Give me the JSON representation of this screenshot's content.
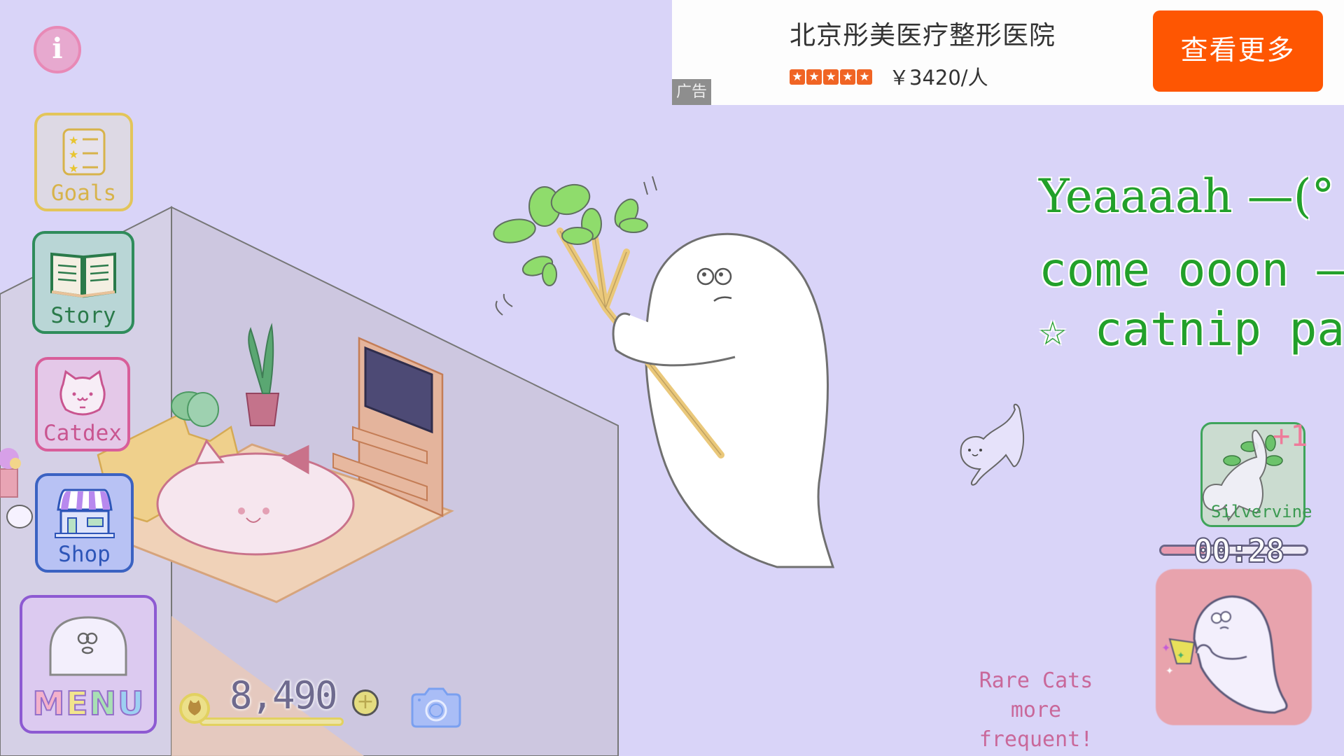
{
  "ad": {
    "title": "北京彤美医疗整形医院",
    "rating_stars": 5,
    "star_glyph": "★",
    "price": "￥3420/人",
    "label": "广告",
    "cta": "查看更多",
    "cta_color": "#fe5602"
  },
  "sidebar": {
    "info_glyph": "i",
    "items": [
      {
        "id": "goals",
        "label": "Goals",
        "icon": "checklist-icon",
        "color": "#e3c55a"
      },
      {
        "id": "story",
        "label": "Story",
        "icon": "book-icon",
        "color": "#2f8c5b"
      },
      {
        "id": "catdex",
        "label": "Catdex",
        "icon": "cat-face-icon",
        "color": "#d85e9a"
      },
      {
        "id": "shop",
        "label": "Shop",
        "icon": "storefront-icon",
        "color": "#3b62c2"
      }
    ],
    "menu": {
      "letters": [
        {
          "ch": "M",
          "color": "#f3b1cb"
        },
        {
          "ch": "E",
          "color": "#f2e58d"
        },
        {
          "ch": "N",
          "color": "#a8e0b4"
        },
        {
          "ch": "U",
          "color": "#9dd0f2"
        }
      ]
    }
  },
  "currency": {
    "value": "8,490",
    "add_glyph": "+"
  },
  "speech": {
    "line1": "Yeaaaah —(°",
    "line2": "come ooon ——",
    "line3": "☆ catnip par"
  },
  "item": {
    "name": "Silvervine",
    "count_badge": "+1",
    "timer": "00:28",
    "timer_progress": 0.3
  },
  "promo": {
    "line1": "Rare Cats",
    "line2": "more frequent!"
  },
  "colors": {
    "background": "#d9d4f8",
    "speech_green": "#22a02a"
  }
}
